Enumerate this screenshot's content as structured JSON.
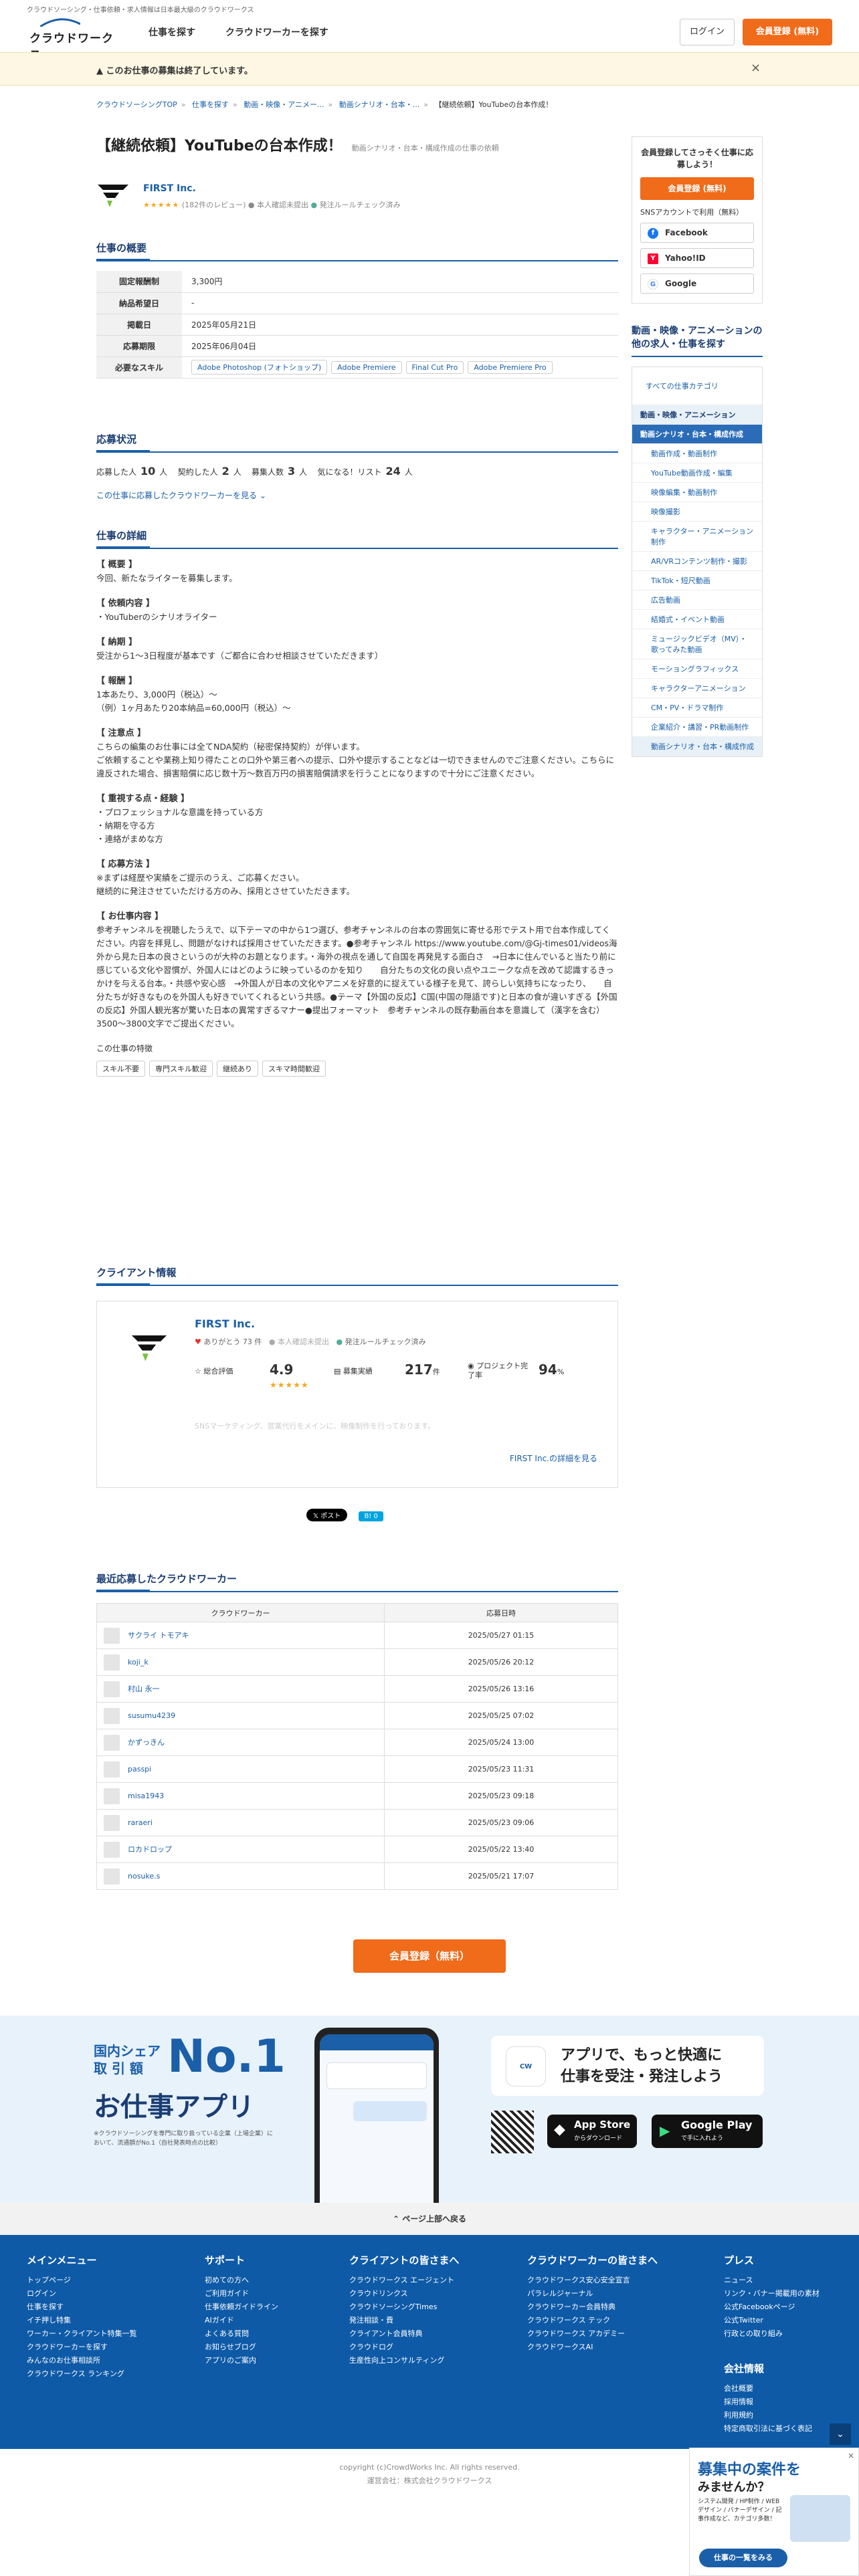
{
  "header": {
    "tagline": "クラウドソーシング・仕事依頼・求人情報は日本最大級のクラウドワークス",
    "logo_text": "クラウドワークス",
    "nav": [
      "仕事を探す",
      "クラウドワーカーを探す"
    ],
    "login": "ログイン",
    "register": "会員登録 (無料)"
  },
  "notice": {
    "text": "このお仕事の募集は終了しています。",
    "close": "×"
  },
  "breadcrumb": [
    "クラウドソーシングTOP",
    "仕事を探す",
    "動画・映像・アニメー...",
    "動画シナリオ・台本・...",
    "【継続依頼】YouTubeの台本作成！"
  ],
  "job": {
    "title": "【継続依頼】YouTubeの台本作成！",
    "category": "動画シナリオ・台本・構成作成の仕事の依頼",
    "client_name": "FIRST Inc.",
    "stars": "★★★★★",
    "reviews": "(182件のレビュー)",
    "identity": "本人確認未提出",
    "rule": "発注ルールチェック済み"
  },
  "overview": {
    "heading": "仕事の概要",
    "rows": [
      {
        "k": "固定報酬制",
        "v": "3,300円"
      },
      {
        "k": "納品希望日",
        "v": "-"
      },
      {
        "k": "掲載日",
        "v": "2025年05月21日"
      },
      {
        "k": "応募期限",
        "v": "2025年06月04日"
      }
    ],
    "skills_label": "必要なスキル",
    "skills": [
      "Adobe Photoshop (フォトショップ)",
      "Adobe Premiere",
      "Final Cut Pro",
      "Adobe Premiere Pro"
    ]
  },
  "status": {
    "heading": "応募状況",
    "applicants_label": "応募した人",
    "applicants": "10",
    "contracted_label": "契約した人",
    "contracted": "2",
    "recruit_label": "募集人数",
    "recruit": "3",
    "watch_label": "気になる！リスト",
    "watch": "24",
    "unit": "人",
    "link": "この仕事に応募したクラウドワーカーを見る"
  },
  "detail": {
    "heading": "仕事の詳細",
    "blocks": [
      {
        "h": "【 概要 】",
        "b": "今回、新たなライターを募集します。"
      },
      {
        "h": "【 依頼内容 】",
        "b": "・YouTuberのシナリオライター"
      },
      {
        "h": "【 納期 】",
        "b": "受注から1〜3日程度が基本です（ご都合に合わせ相談させていただきます）"
      },
      {
        "h": "【 報酬 】",
        "b": "1本あたり、3,000円（税込）〜\n（例）1ヶ月あたり20本納品=60,000円（税込）〜"
      },
      {
        "h": "【 注意点 】",
        "b": "こちらの編集のお仕事には全てNDA契約（秘密保持契約）が伴います。\nご依頼することや業務上知り得たことの口外や第三者への提示、口外や提示することなどは一切できませんのでご注意ください。こちらに違反された場合、損害賠償に応じ数十万〜数百万円の損害賠償請求を行うことになりますので十分にご注意ください。"
      },
      {
        "h": "【 重視する点・経験 】",
        "b": "・プロフェッショナルな意識を持っている方\n・納期を守る方\n・連絡がまめな方"
      },
      {
        "h": "【 応募方法 】",
        "b": "※まずは経歴や実績をご提示のうえ、ご応募ください。\n継続的に発注させていただける方のみ、採用とさせていただきます。"
      },
      {
        "h": "【 お仕事内容 】",
        "b": "参考チャンネルを視聴したうえで、以下テーマの中から1つ選び、参考チャンネルの台本の雰囲気に寄せる形でテスト用で台本作成してください。内容を拝見し、問題がなければ採用させていただきます。●参考チャンネル https://www.youtube.com/@Gj-times01/videos海外から見た日本の良さというのが大枠のお題となります。・海外の視点を通して自国を再発見する面白さ　→日本に住んでいると当たり前に感じている文化や習慣が、外国人にはどのように映っているのかを知り　　自分たちの文化の良い点やユニークな点を改めて認識するきっかけを与える台本。・共感や安心感　→外国人が日本の文化やアニメを好意的に捉えている様子を見て、誇らしい気持ちになったり、　　自分たちが好きなものを外国人も好きでいてくれるという共感。●テーマ【外国の反応】C国(中国の隠語です)と日本の食が違いすぎる【外国の反応】外国人観光客が驚いた日本の異常すぎるマナー●提出フォーマット　参考チャンネルの既存動画台本を意識して（漢字を含む）3500〜3800文字でご提出ください。"
      }
    ],
    "features_label": "この仕事の特徴",
    "features": [
      "スキル不要",
      "専門スキル歓迎",
      "継続あり",
      "スキマ時間歓迎"
    ]
  },
  "client_info": {
    "heading": "クライアント情報",
    "name": "FIRST Inc.",
    "thanks": "ありがとう 73 件",
    "identity": "本人確認未提出",
    "rule": "発注ルールチェック済み",
    "rating_label": "総合評価",
    "rating": "4.9",
    "stars": "★★★★★",
    "orders_label": "募集実績",
    "orders": "217",
    "orders_unit": "件",
    "complete_label": "プロジェクト完了率",
    "complete": "94",
    "complete_unit": "%",
    "desc": "SNSマーケティング、営業代行をメインに、映像制作を行っております。",
    "more": "FIRST Inc.の詳細を見る"
  },
  "share": {
    "x": "𝕏 ポスト",
    "hatena": "B! 0"
  },
  "applicants": {
    "heading": "最近応募したクラウドワーカー",
    "col_worker": "クラウドワーカー",
    "col_date": "応募日時",
    "rows": [
      {
        "name": "サクライ トモアキ",
        "date": "2025/05/27 01:15"
      },
      {
        "name": "koji_k",
        "date": "2025/05/26 20:12"
      },
      {
        "name": "村山 永一",
        "date": "2025/05/26 13:16"
      },
      {
        "name": "susumu4239",
        "date": "2025/05/25 07:02"
      },
      {
        "name": "かずっきん",
        "date": "2025/05/24 13:00"
      },
      {
        "name": "passpi",
        "date": "2025/05/23 11:31"
      },
      {
        "name": "misa1943",
        "date": "2025/05/23 09:18"
      },
      {
        "name": "raraeri",
        "date": "2025/05/23 09:06"
      },
      {
        "name": "ロカドロップ",
        "date": "2025/05/22 13:40"
      },
      {
        "name": "nosuke.s",
        "date": "2025/05/21 17:07"
      }
    ]
  },
  "cta": "会員登録（無料）",
  "side": {
    "reg_text": "会員登録してさっそく仕事に応募しよう！",
    "reg_btn": "会員登録 (無料)",
    "sns_label": "SNSアカウントで利用（無料）",
    "facebook": "Facebook",
    "yahoo": "Yahoo!ID",
    "google": "Google",
    "cat_heading": "動画・映像・アニメーションの他の求人・仕事を探す",
    "all": "すべての仕事カテゴリ",
    "group": "動画・映像・アニメーション",
    "active": "動画シナリオ・台本・構成作成",
    "items": [
      "動画作成・動画制作",
      "YouTube動画作成・編集",
      "映像編集・動画制作",
      "映像撮影",
      "キャラクター・アニメーション制作",
      "AR/VRコンテンツ制作・撮影",
      "TikTok・短尺動画",
      "広告動画",
      "結婚式・イベント動画",
      "ミュージックビデオ（MV）・歌ってみた動画",
      "モーショングラフィックス",
      "キャラクターアニメーション",
      "CM・PV・ドラマ制作",
      "企業紹介・講習・PR動画制作"
    ],
    "current": "動画シナリオ・台本・構成作成"
  },
  "app": {
    "share1": "国内シェア",
    "share2": "取 引 額",
    "no1": "No.1",
    "title": "お仕事アプリ",
    "note": "※クラウドソーシングを専門に取り扱っている企業（上場企業）において、流通額がNo.1（自社発表時点の比較）",
    "catch1": "アプリで、もっと快適に",
    "catch2": "仕事を受注・発注しよう",
    "appstore_small": "App Storeから",
    "appstore": "App Store",
    "appstore_sub": "からダウンロード",
    "gplay_small": "GET IT ON",
    "gplay": "Google Play",
    "gplay_sub": "で手に入れよう"
  },
  "pagetop": "ページ上部へ戻る",
  "footer": {
    "cols": [
      {
        "h": "メインメニュー",
        "items": [
          "トップページ",
          "ログイン",
          "仕事を探す",
          "イチ押し特集",
          "ワーカー・クライアント特集一覧",
          "クラウドワーカーを探す",
          "みんなのお仕事相談所",
          "クラウドワークス ランキング"
        ]
      },
      {
        "h": "サポート",
        "items": [
          "初めての方へ",
          "ご利用ガイド",
          "仕事依頼ガイドライン",
          "AIガイド",
          "よくある質問",
          "お知らせブログ",
          "アプリのご案内"
        ]
      },
      {
        "h": "クライアントの皆さまへ",
        "items": [
          "クラウドワークス エージェント",
          "クラウドリンクス",
          "クラウドソーシングTimes",
          "発注相談・費",
          "クライアント会員特典",
          "クラウドログ",
          "生産性向上コンサルティング"
        ]
      },
      {
        "h": "クラウドワーカーの皆さまへ",
        "items": [
          "クラウドワークス安心安全宣言",
          "パラレルジャーナル",
          "クラウドワーカー会員特典",
          "クラウドワークス テック",
          "クラウドワークス アカデミー",
          "クラウドワークスAI"
        ]
      },
      {
        "h": "プレス",
        "items": [
          "ニュース",
          "リンク・バナー掲載用の素材",
          "公式Facebookページ",
          "公式Twitter",
          "行政との取り組み"
        ]
      }
    ],
    "company_h": "会社情報",
    "company": [
      "会社概要",
      "採用情報",
      "利用規約",
      "特定商取引法に基づく表記"
    ],
    "copyright": "copyright (c)CrowdWorks Inc. All rights reserved.",
    "operator": "運営会社：株式会社クラウドワークス"
  },
  "float_banner": {
    "t1": "募集中の案件を",
    "t2": "みませんか？",
    "t3": "システム開発 / HP制作 / WEBデザイン / バナーデザイン / 記事作成など、カテゴリ多数！",
    "btn": "仕事の一覧をみる"
  },
  "colors": {
    "accent": "#f06b1a",
    "brand": "#1a5fa8",
    "footer": "#0e5aa7"
  }
}
